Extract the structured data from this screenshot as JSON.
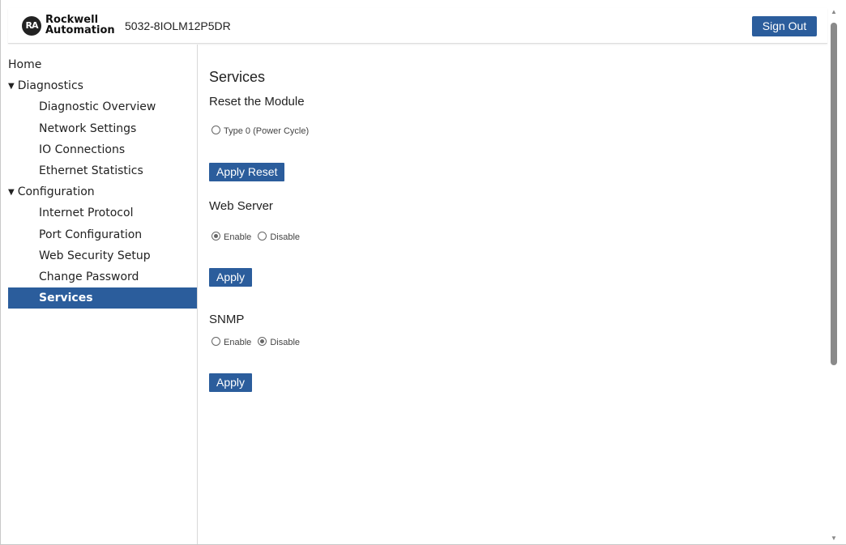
{
  "header": {
    "logo_text": "RA",
    "brand_line1": "Rockwell",
    "brand_line2": "Automation",
    "device_name": "5032-8IOLM12P5DR",
    "signout_label": "Sign Out"
  },
  "sidebar": {
    "items": [
      {
        "label": "Home",
        "level": 0,
        "active": false
      },
      {
        "label": "Diagnostics",
        "level": 0,
        "expanded": true,
        "active": false
      },
      {
        "label": "Diagnostic Overview",
        "level": 1,
        "active": false
      },
      {
        "label": "Network Settings",
        "level": 1,
        "active": false
      },
      {
        "label": "IO Connections",
        "level": 1,
        "active": false
      },
      {
        "label": "Ethernet Statistics",
        "level": 1,
        "active": false
      },
      {
        "label": "Configuration",
        "level": 0,
        "expanded": true,
        "active": false
      },
      {
        "label": "Internet Protocol",
        "level": 1,
        "active": false
      },
      {
        "label": "Port Configuration",
        "level": 1,
        "active": false
      },
      {
        "label": "Web Security Setup",
        "level": 1,
        "active": false
      },
      {
        "label": "Change Password",
        "level": 1,
        "active": false
      },
      {
        "label": "Services",
        "level": 1,
        "active": true
      }
    ],
    "caret": "▼"
  },
  "main": {
    "title": "Services",
    "reset": {
      "title": "Reset the Module",
      "option_label": "Type 0 (Power Cycle)",
      "option_checked": false,
      "button_label": "Apply Reset"
    },
    "web_server": {
      "title": "Web Server",
      "enable_label": "Enable",
      "disable_label": "Disable",
      "selected": "enable",
      "button_label": "Apply"
    },
    "snmp": {
      "title": "SNMP",
      "enable_label": "Enable",
      "disable_label": "Disable",
      "selected": "disable",
      "button_label": "Apply"
    }
  },
  "colors": {
    "accent": "#2b5d9c"
  }
}
